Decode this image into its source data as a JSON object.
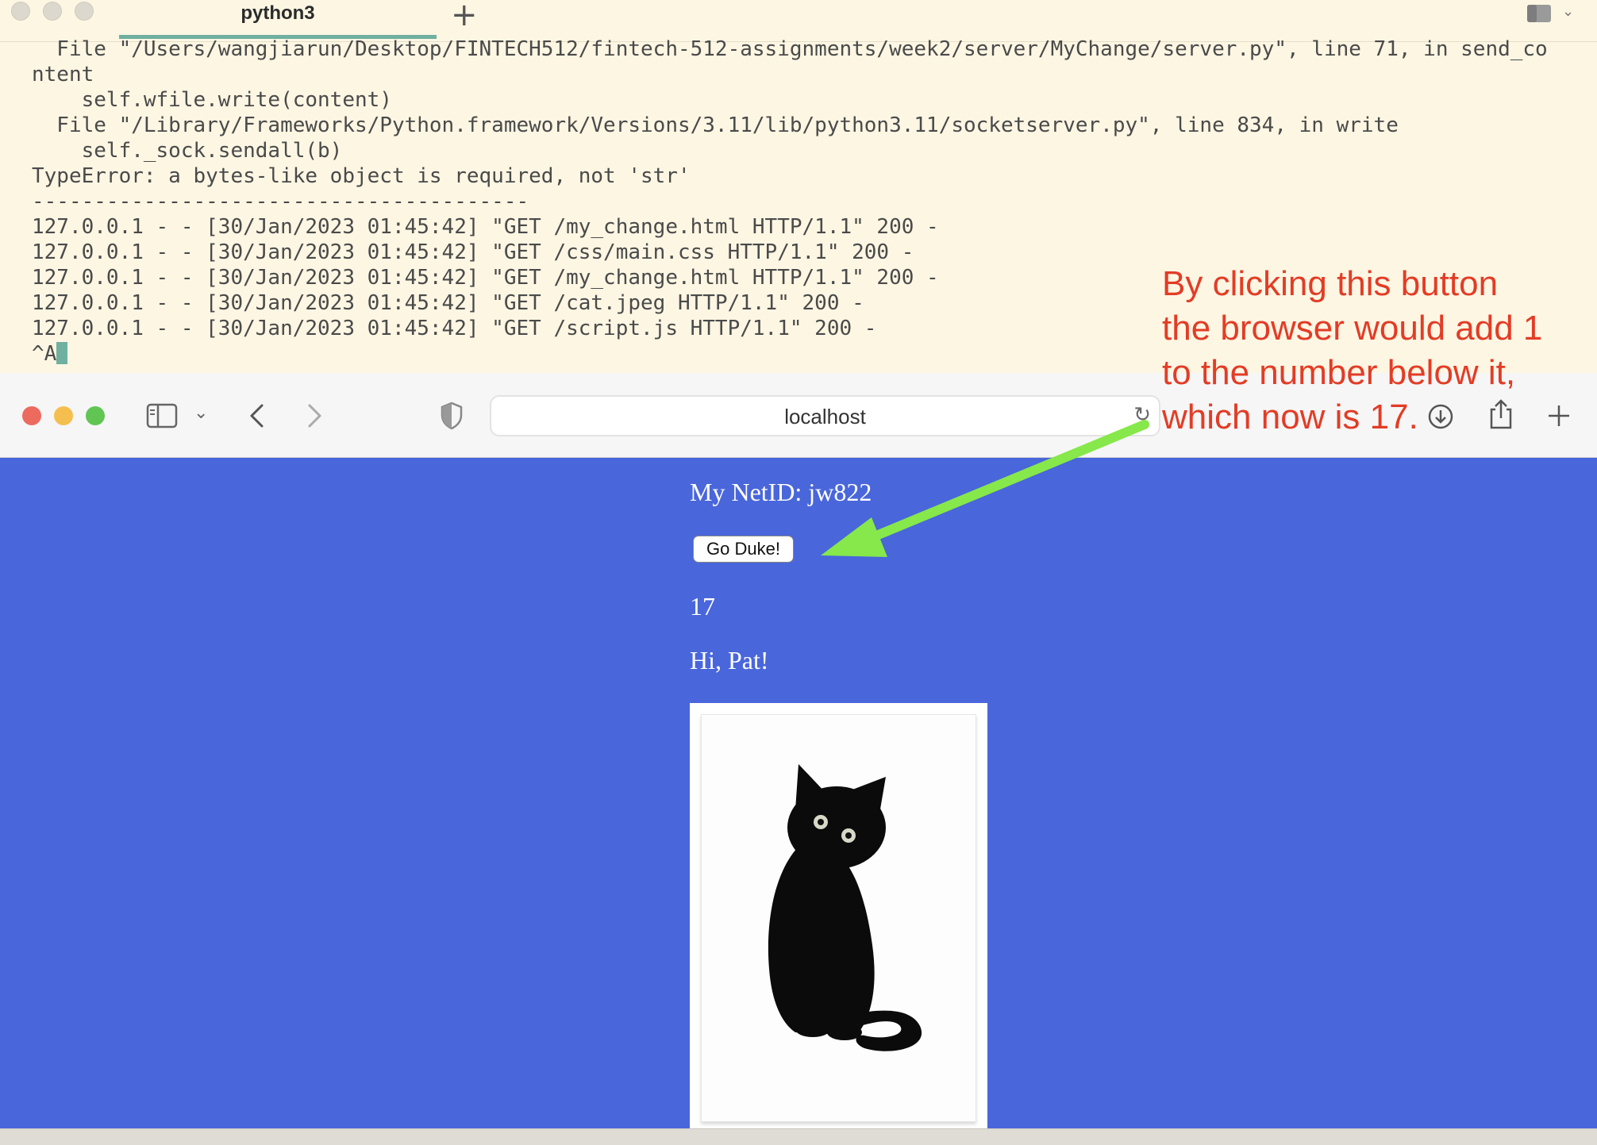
{
  "terminal": {
    "tab_label": "python3",
    "new_tab_icon": "plus-icon",
    "lines": [
      "  File \"/Users/wangjiarun/Desktop/FINTECH512/fintech-512-assignments/week2/server/MyChange/server.py\", line 71, in send_co",
      "ntent",
      "    self.wfile.write(content)",
      "  File \"/Library/Frameworks/Python.framework/Versions/3.11/lib/python3.11/socketserver.py\", line 834, in write",
      "    self._sock.sendall(b)",
      "TypeError: a bytes-like object is required, not 'str'",
      "----------------------------------------",
      "127.0.0.1 - - [30/Jan/2023 01:45:42] \"GET /my_change.html HTTP/1.1\" 200 -",
      "127.0.0.1 - - [30/Jan/2023 01:45:42] \"GET /css/main.css HTTP/1.1\" 200 -",
      "127.0.0.1 - - [30/Jan/2023 01:45:42] \"GET /my_change.html HTTP/1.1\" 200 -",
      "127.0.0.1 - - [30/Jan/2023 01:45:42] \"GET /cat.jpeg HTTP/1.1\" 200 -",
      "127.0.0.1 - - [30/Jan/2023 01:45:42] \"GET /script.js HTTP/1.1\" 200 -"
    ],
    "prompt": "^A",
    "colors": {
      "background": "#fcf6e3",
      "text": "#4a4a4a",
      "accent": "#6fb0a0"
    }
  },
  "browser": {
    "url": "localhost",
    "icons": [
      "sidebar-icon",
      "chevron-down-icon",
      "back-icon",
      "forward-icon",
      "shield-icon",
      "reload-icon",
      "download-icon",
      "share-icon",
      "new-tab-icon"
    ],
    "page": {
      "netid": "My NetID: jw822",
      "button_label": "Go Duke!",
      "counter": "17",
      "greeting": "Hi, Pat!",
      "image": "cat-image",
      "background_color": "#4966db"
    }
  },
  "annotation": {
    "lines": [
      "By clicking this button",
      "the browser would add 1",
      "to the number below it,",
      "which now is 17."
    ],
    "color": "#e33c26",
    "arrow_color": "#86e84a"
  }
}
